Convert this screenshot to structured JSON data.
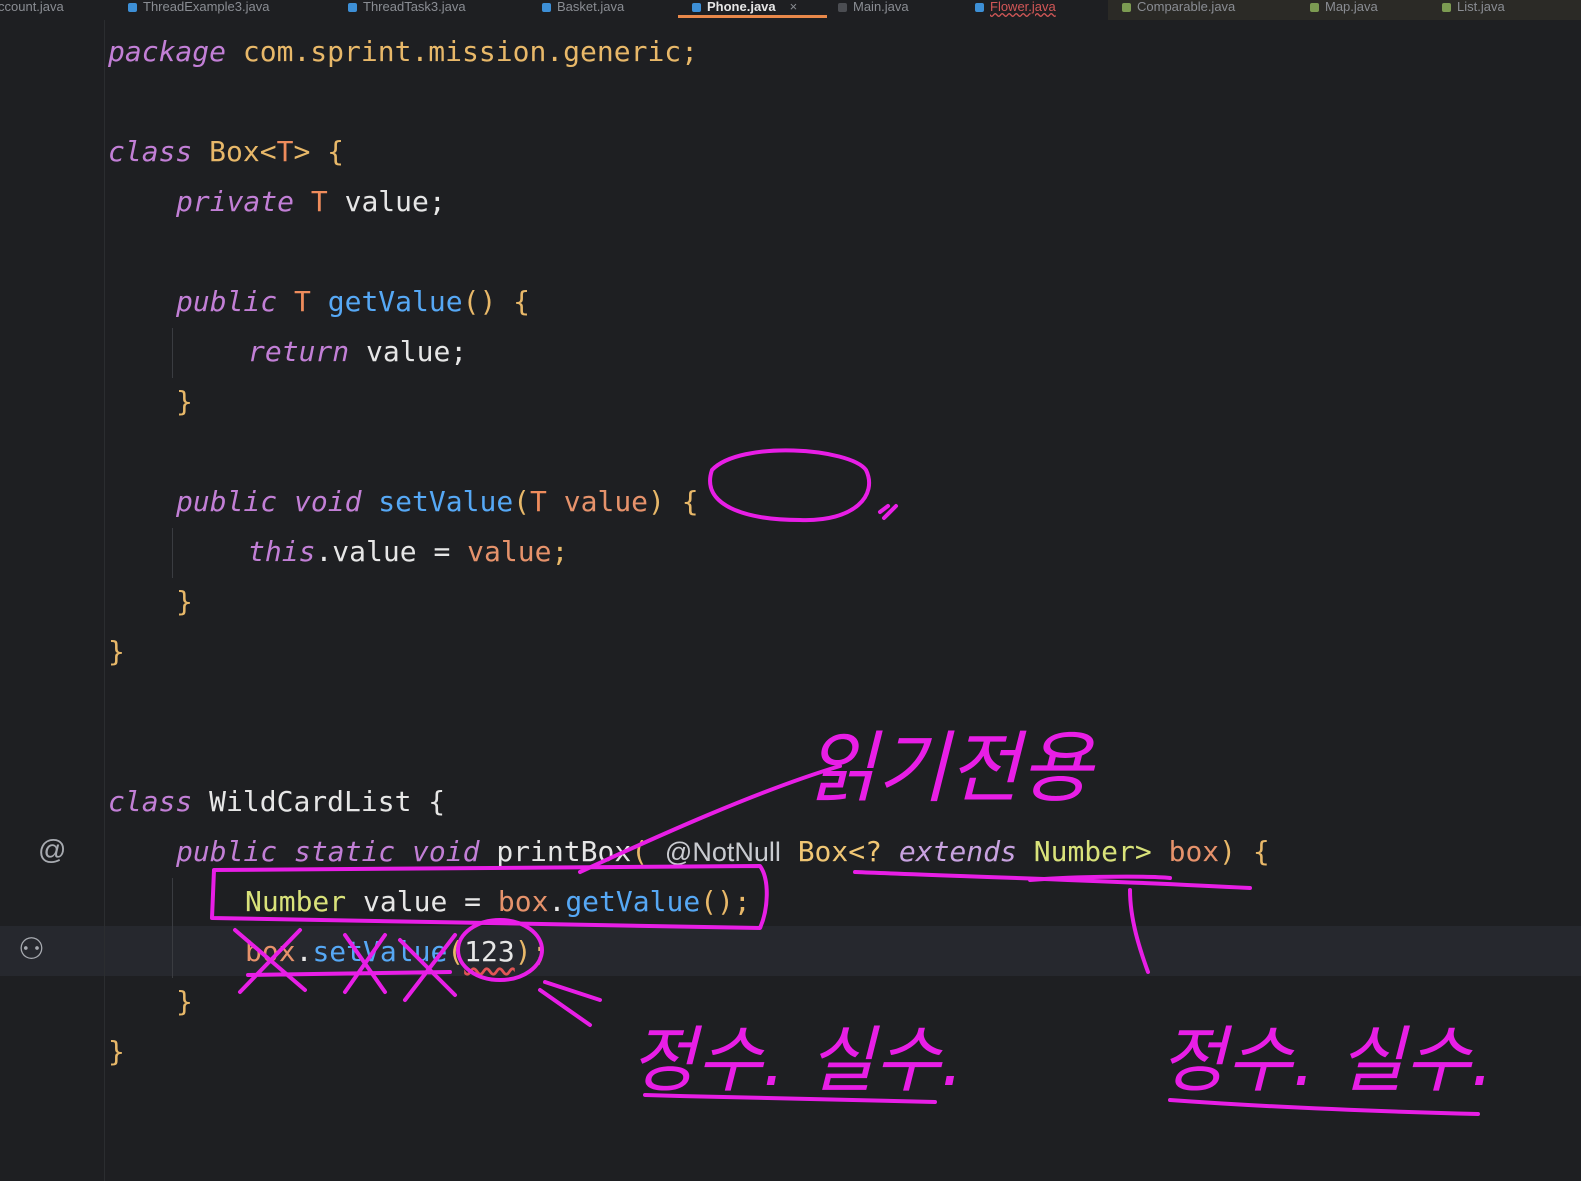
{
  "tabs": [
    {
      "label": "ccount.java",
      "kind": "class"
    },
    {
      "label": "ThreadExample3.java",
      "kind": "class"
    },
    {
      "label": "ThreadTask3.java",
      "kind": "class"
    },
    {
      "label": "Basket.java",
      "kind": "class"
    },
    {
      "label": "Phone.java",
      "kind": "class",
      "active": true,
      "close": "×"
    },
    {
      "label": "Main.java",
      "kind": "main"
    },
    {
      "label": "Flower.java",
      "kind": "class",
      "error": true
    },
    {
      "label": "Comparable.java",
      "kind": "interface"
    },
    {
      "label": "Map.java",
      "kind": "interface"
    },
    {
      "label": "List.java",
      "kind": "interface"
    }
  ],
  "code": {
    "l1": {
      "kw": "package",
      "rest": " com.sprint.mission.generic;"
    },
    "l3": {
      "kw": "class",
      "name": " Box<",
      "tparam": "T",
      "close": "> {"
    },
    "l4": {
      "kw": "private",
      "tparam": " T",
      "rest": " value;"
    },
    "l6": {
      "kw": "public",
      "tparam": " T",
      "fn": " getValue",
      "rest": "() {"
    },
    "l7": {
      "kw": "return",
      "rest": " value;"
    },
    "l8": {
      "brace": "}"
    },
    "l10": {
      "kw1": "public",
      "kw2": " void",
      "fn": " setValue",
      "p1": "(",
      "tparam": "T",
      "param": " value",
      "rest": ") {"
    },
    "l11": {
      "kw": "this",
      "dot": ".",
      "field": "value",
      "eq": " = ",
      "param": "value",
      "end": ";"
    },
    "l12": {
      "brace": "}"
    },
    "l13": {
      "brace": "}"
    },
    "l16": {
      "kw": "class",
      "rest": " WildCardList {"
    },
    "l17": {
      "kw1": "public",
      "kw2": " static",
      "kw3": " void",
      "fn": " printBox",
      "p1": "( ",
      "ann": "@NotNull",
      "tp": " Box<? ",
      "kw4": "extends",
      "tp2": " Number> ",
      "param": "box",
      "rest": ") {"
    },
    "l18": {
      "tp": "Number",
      "rest": " value = ",
      "var": "box",
      "dot": ".",
      "fn": "getValue",
      "end": "();"
    },
    "l19": {
      "var": "box",
      "dot": ".",
      "fn": "setValue",
      "p1": "(",
      "num": "123",
      "end": ");"
    },
    "l20": {
      "brace": "}"
    },
    "l21": {
      "brace": "}"
    }
  },
  "gutter": {
    "override_marker": "@",
    "ai_icon": "⚇"
  },
  "handwriting": {
    "top": "읽기전용",
    "bottom_left": "정수. 실수.",
    "bottom_right": "정수. 실수."
  },
  "colors": {
    "annotation_ink": "#e81ee6",
    "background": "#1e1f22"
  }
}
